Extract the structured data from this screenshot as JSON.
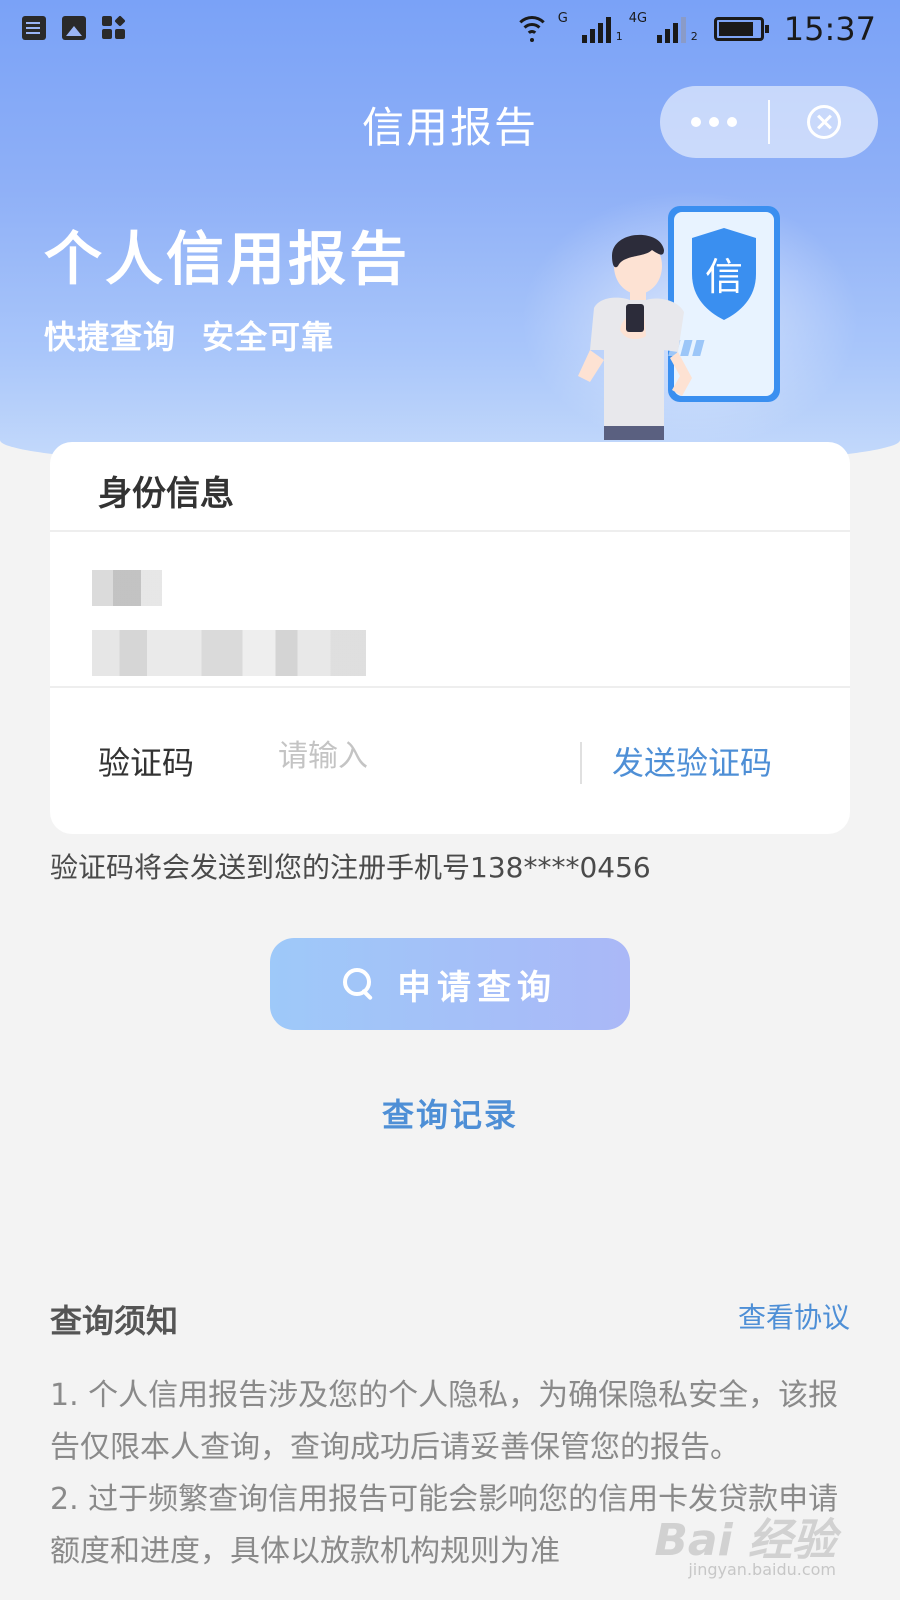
{
  "status_bar": {
    "time": "15:37",
    "sim1_tag": "G",
    "sim1_index": "1",
    "sim2_tag": "4G",
    "sim2_index": "2"
  },
  "nav": {
    "title": "信用报告"
  },
  "hero": {
    "title": "个人信用报告",
    "tagline_1": "快捷查询",
    "tagline_2": "安全可靠",
    "badge_char": "信"
  },
  "identity_card": {
    "title": "身份信息",
    "code_label": "验证码",
    "code_placeholder": "请输入",
    "send_code_label": "发送验证码"
  },
  "hint": "验证码将会发送到您的注册手机号138****0456",
  "apply_button_label": "申请查询",
  "records_link": "查询记录",
  "notice": {
    "title": "查询须知",
    "agreement_link": "查看协议",
    "items": [
      "1. 个人信用报告涉及您的个人隐私，为确保隐私安全，该报告仅限本人查询，查询成功后请妥善保管您的报告。",
      "2. 过于频繁查询信用报告可能会影响您的信用卡发贷款申请额度和进度，具体以放款机构规则为准"
    ]
  },
  "watermark": {
    "logo": "Bai 经验",
    "url": "jingyan.baidu.com"
  },
  "colors": {
    "accent": "#4e8fd6",
    "hero": "#7aa2f7",
    "button_start": "#9ec9f9",
    "button_end": "#aab8f7"
  }
}
